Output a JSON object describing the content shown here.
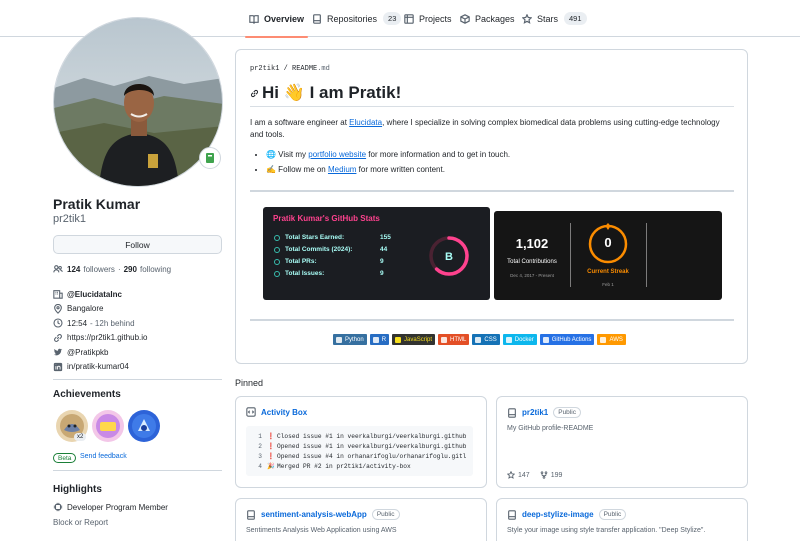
{
  "nav": {
    "tabs": [
      {
        "label": "Overview",
        "icon": "book-icon",
        "count": ""
      },
      {
        "label": "Repositories",
        "icon": "repo-icon",
        "count": "23"
      },
      {
        "label": "Projects",
        "icon": "project-icon",
        "count": ""
      },
      {
        "label": "Packages",
        "icon": "package-icon",
        "count": ""
      },
      {
        "label": "Stars",
        "icon": "star-icon",
        "count": "491"
      }
    ],
    "active": "Overview"
  },
  "profile": {
    "name": "Pratik Kumar",
    "login": "pr2tik1",
    "follow_label": "Follow",
    "followers": "124",
    "followers_label": "followers",
    "following": "290",
    "following_label": "following",
    "details": [
      {
        "icon": "organization-icon",
        "text": "@ElucidataInc",
        "bold": true,
        "muted": ""
      },
      {
        "icon": "location-icon",
        "text": "Bangalore",
        "bold": false,
        "muted": ""
      },
      {
        "icon": "clock-icon",
        "text": "12:54",
        "bold": false,
        "muted": "- 12h behind"
      },
      {
        "icon": "link-icon",
        "text": "https://pr2tik1.github.io",
        "bold": false,
        "muted": ""
      },
      {
        "icon": "twitter-icon",
        "text": "@Pratikpkb",
        "bold": false,
        "muted": ""
      },
      {
        "icon": "linkedin-icon",
        "text": "in/pratik-kumar04",
        "bold": false,
        "muted": ""
      }
    ]
  },
  "achievements": {
    "title": "Achievements",
    "multiplier": "x2",
    "beta_label": "Beta",
    "feedback_label": "Send feedback"
  },
  "highlights": {
    "title": "Highlights",
    "items": [
      "Developer Program Member"
    ],
    "block_label": "Block or Report"
  },
  "readme": {
    "path_user": "pr2tik1",
    "path_sep": " / ",
    "path_file": "README",
    "path_ext": ".md",
    "heading": "Hi 👋 I am Pratik!",
    "intro_before": "I am a software engineer at ",
    "intro_link": "Elucidata",
    "intro_after": ", where I specialize in solving complex biomedical data problems using cutting-edge technology and tools.",
    "bullet1_pre": "🌐 Visit my ",
    "bullet1_link": "portfolio website",
    "bullet1_post": " for more information and to get in touch.",
    "bullet2_pre": "✍️ Follow me on ",
    "bullet2_link": "Medium",
    "bullet2_post": " for more written content."
  },
  "stats_card": {
    "title": "Pratik Kumar's GitHub Stats",
    "rows": [
      {
        "label": "Total Stars Earned:",
        "value": "155"
      },
      {
        "label": "Total Commits (2024):",
        "value": "44"
      },
      {
        "label": "Total PRs:",
        "value": "9"
      },
      {
        "label": "Total Issues:",
        "value": "9"
      }
    ],
    "grade": "B",
    "grade_progress": 0.62
  },
  "streak_card": {
    "total": "1,102",
    "total_label": "Total Contributions",
    "total_range": "Dec 4, 2017 - Present",
    "current": "0",
    "current_label": "Current Streak",
    "current_sub": "Feb 1",
    "longest_label": "",
    "longest": ""
  },
  "tech_badges": [
    {
      "label": "Python",
      "color": "#3670a0"
    },
    {
      "label": "R",
      "color": "#276dc3"
    },
    {
      "label": "JavaScript",
      "color": "#323330"
    },
    {
      "label": "HTML",
      "color": "#e34f26"
    },
    {
      "label": "CSS",
      "color": "#1572b6"
    },
    {
      "label": "Docker",
      "color": "#0db7ed"
    },
    {
      "label": "GitHub Actions",
      "color": "#2671e5"
    },
    {
      "label": "AWS",
      "color": "#ff9900"
    }
  ],
  "pinned": {
    "title": "Pinned",
    "cards": [
      {
        "name": "Activity Box",
        "code": [
          {
            "n": "1",
            "mark": "❗",
            "text": "Closed issue #1 in veerkalburgi/veerkalburgi.github"
          },
          {
            "n": "2",
            "mark": "❗",
            "text": "Opened issue #1 in veerkalburgi/veerkalburgi.github"
          },
          {
            "n": "3",
            "mark": "❗",
            "text": "Opened issue #4 in orhanarifoglu/orhanarifoglu.gitl"
          },
          {
            "n": "4",
            "mark": "🎉",
            "text": "Merged PR #2 in pr2tik1/activity-box"
          }
        ]
      },
      {
        "name": "pr2tik1",
        "visibility": "Public",
        "desc": "My GitHub profile-README",
        "stars": "147",
        "forks": "199"
      },
      {
        "name": "sentiment-analysis-webApp",
        "visibility": "Public",
        "desc": "Sentiments Analysis Web Application using AWS"
      },
      {
        "name": "deep-stylize-image",
        "visibility": "Public",
        "desc": "Style your image using style transfer application. \"Deep Stylize\"."
      }
    ]
  },
  "colors": {
    "accent": "#fd8c73",
    "link": "#0969da",
    "stats_title": "#fe428e",
    "stats_text": "#a9fef7",
    "streak_accent": "#fb8c00"
  }
}
